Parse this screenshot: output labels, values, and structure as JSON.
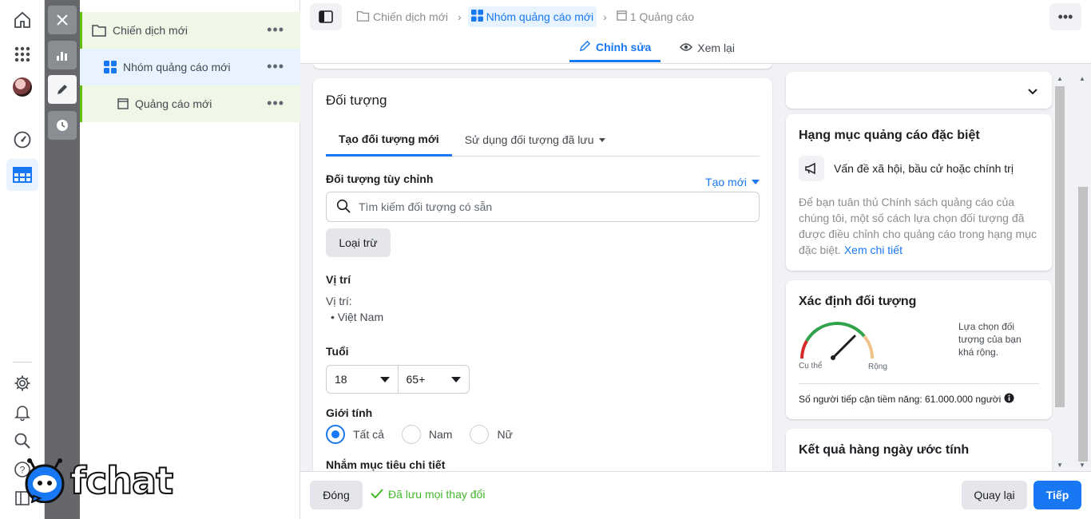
{
  "tree": {
    "campaign": "Chiến dịch mới",
    "adset": "Nhóm quảng cáo mới",
    "ad": "Quảng cáo mới",
    "dots": "•••"
  },
  "header": {
    "breadcrumbs": [
      "Chiến dịch mới",
      "Nhóm quảng cáo mới",
      "1 Quảng cáo"
    ],
    "more": "•••",
    "tabs": {
      "edit": "Chỉnh sửa",
      "review": "Xem lại"
    }
  },
  "audience": {
    "title": "Đối tượng",
    "tab_new": "Tạo đối tượng mới",
    "tab_saved": "Sử dụng đối tượng đã lưu",
    "custom_label": "Đối tượng tùy chỉnh",
    "create_new": "Tạo mới",
    "search_placeholder": "Tìm kiếm đối tượng có sẵn",
    "exclude": "Loại trừ",
    "location_label": "Vị trí",
    "location_sub": "Vị trí:",
    "location_value": "• Việt Nam",
    "age_label": "Tuổi",
    "age_min": "18",
    "age_max": "65+",
    "gender_label": "Giới tính",
    "gender_options": [
      "Tất cả",
      "Nam",
      "Nữ"
    ],
    "gender_selected": "Tất cả",
    "detailed_label": "Nhắm mục tiêu chi tiết"
  },
  "special": {
    "title": "Hạng mục quảng cáo đặc biệt",
    "item": "Vấn đề xã hội, bầu cử hoặc chính trị",
    "desc": "Để bạn tuân thủ Chính sách quảng cáo của chúng tôi, một số cách lựa chọn đối tượng đã được điều chỉnh cho quảng cáo trong hạng mục đặc biệt.",
    "link": "Xem chi tiết"
  },
  "define": {
    "title": "Xác định đối tượng",
    "specific": "Cụ thể",
    "broad": "Rộng",
    "note": "Lựa chọn đối tượng của bạn khá rộng.",
    "reach": "Số người tiếp cận tiềm năng: 61.000.000 người"
  },
  "daily": {
    "title": "Kết quả hàng ngày ước tính"
  },
  "footer": {
    "close": "Đóng",
    "saved": "Đã lưu mọi thay đổi",
    "back": "Quay lại",
    "next": "Tiếp"
  },
  "logo": "fchat",
  "colors": {
    "accent": "#1877f2",
    "success": "#42b72a",
    "campaign_marker": "#63be09"
  }
}
